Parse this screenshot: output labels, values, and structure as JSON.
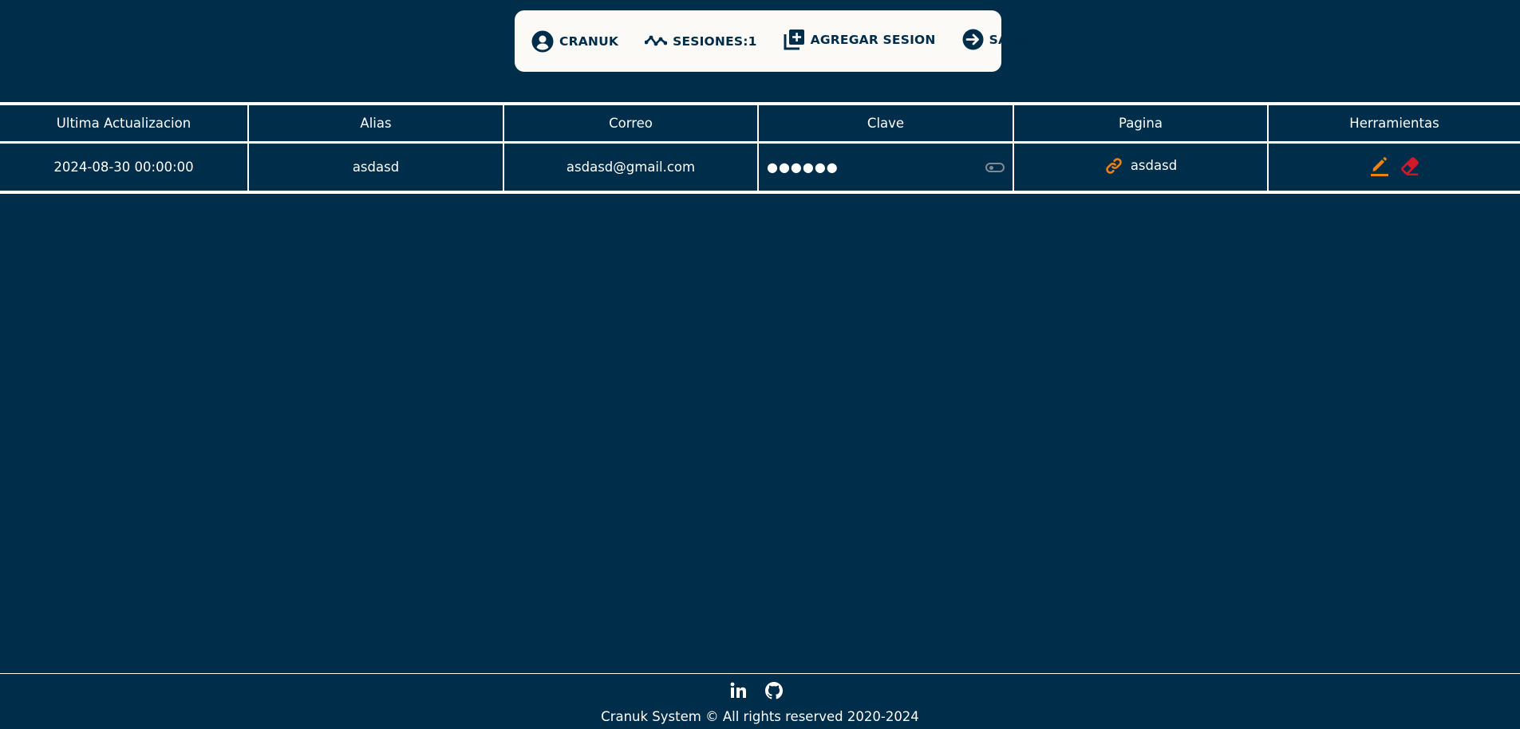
{
  "nav": {
    "user_label": "CRANUK",
    "sessions_label": "SESIONES:1",
    "add_session_label": "AGREGAR SESION",
    "logout_label": "SALIR",
    "icons": [
      "user-circle-icon",
      "activity-icon",
      "add-box-icon",
      "logout-circle-icon"
    ]
  },
  "table": {
    "headers": [
      "Ultima Actualizacion",
      "Alias",
      "Correo",
      "Clave",
      "Pagina",
      "Herramientas"
    ],
    "rows": [
      {
        "updated": "2024-08-30 00:00:00",
        "alias": "asdasd",
        "email": "asdasd@gmail.com",
        "password_masked": "●●●●●●",
        "page": "asdasd"
      }
    ]
  },
  "colors": {
    "background": "#002d4a",
    "nav_bg": "#fbfaf7",
    "edit_icon": "#f0820f",
    "delete_icon": "#d0192a",
    "link_icon": "#f0820f"
  },
  "footer": {
    "copyright": "Cranuk System © All rights reserved 2020-2024",
    "social": [
      "linkedin-icon",
      "github-icon"
    ]
  }
}
